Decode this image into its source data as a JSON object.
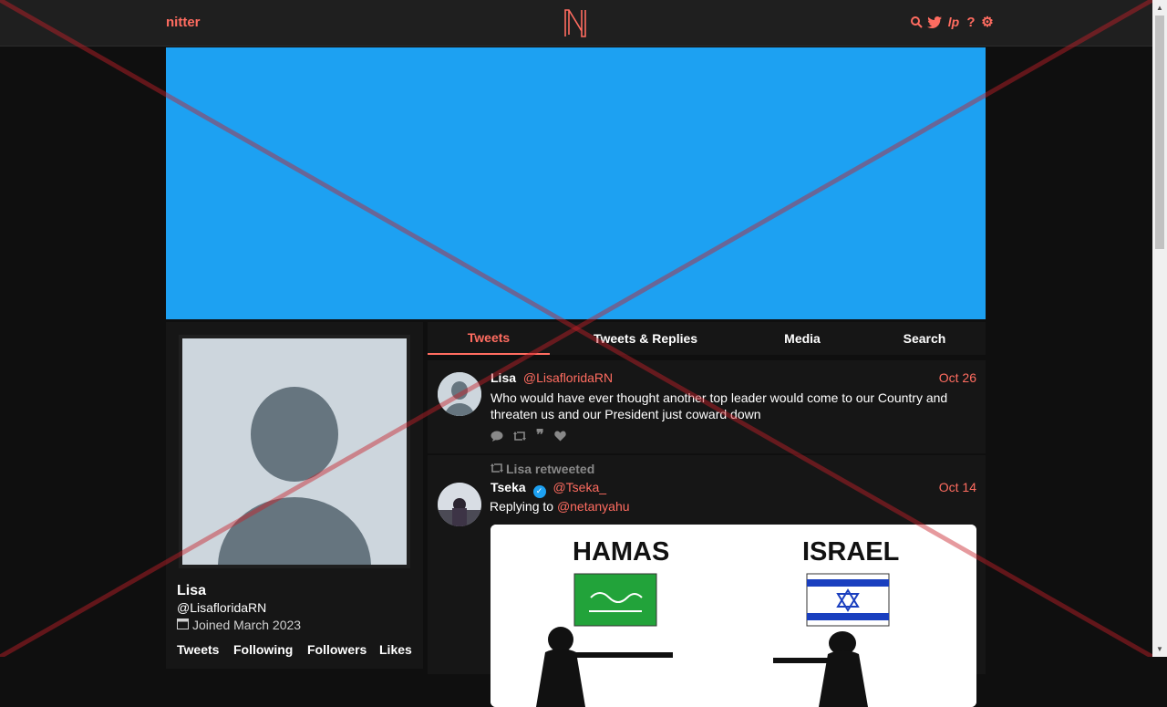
{
  "navbar": {
    "brand": "nitter",
    "logo_letter": "N",
    "icons": [
      "search-icon",
      "twitter-icon",
      "liberapay-icon",
      "help-icon",
      "gear-icon"
    ]
  },
  "profile": {
    "name": "Lisa",
    "handle": "@LisafloridaRN",
    "joined": "Joined March 2023",
    "stats": [
      "Tweets",
      "Following",
      "Followers",
      "Likes"
    ]
  },
  "tabs": [
    {
      "label": "Tweets",
      "active": true
    },
    {
      "label": "Tweets & Replies",
      "active": false
    },
    {
      "label": "Media",
      "active": false
    },
    {
      "label": "Search",
      "active": false
    }
  ],
  "tweets": [
    {
      "name": "Lisa",
      "handle": "@LisafloridaRN",
      "date": "Oct 26",
      "text": "Who would have ever thought another top leader would come to our Country and threaten us and our President just coward down"
    },
    {
      "retweet_label": "Lisa retweeted",
      "name": "Tseka",
      "handle": "@Tseka_",
      "date": "Oct 14",
      "replying_prefix": "Replying to",
      "replying_to": "@netanyahu",
      "media_labels": [
        "HAMAS",
        "ISRAEL"
      ]
    }
  ],
  "colors": {
    "accent": "#ff6c60",
    "banner": "#1da1f2",
    "background": "#0f0f0f",
    "panel": "#161616"
  }
}
